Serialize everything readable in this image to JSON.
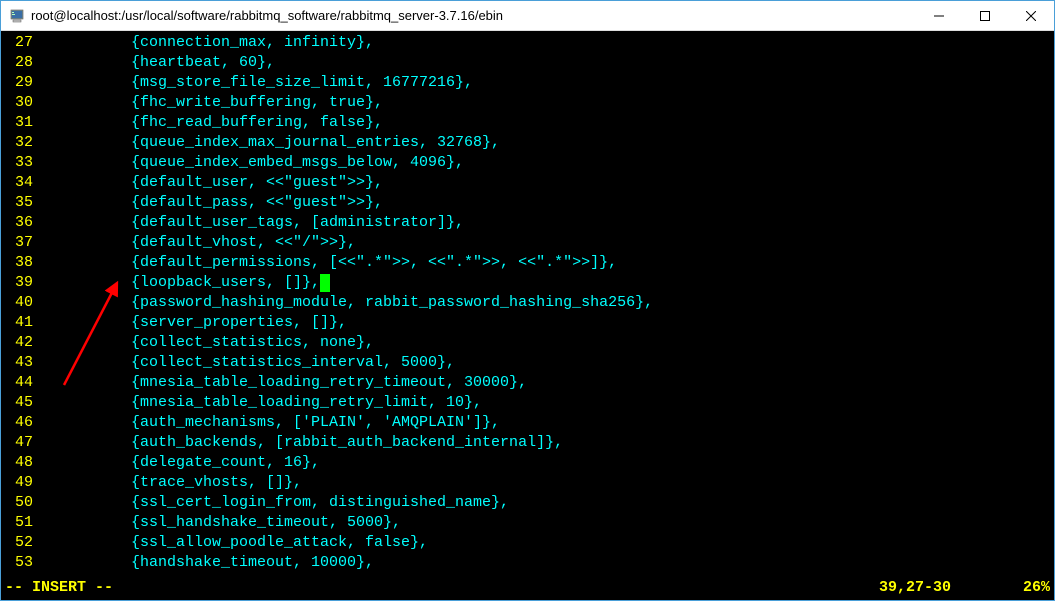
{
  "window": {
    "title": "root@localhost:/usr/local/software/rabbitmq_software/rabbitmq_server-3.7.16/ebin"
  },
  "lines": [
    {
      "n": "27",
      "t": "{connection_max, infinity},"
    },
    {
      "n": "28",
      "t": "{heartbeat, 60},"
    },
    {
      "n": "29",
      "t": "{msg_store_file_size_limit, 16777216},"
    },
    {
      "n": "30",
      "t": "{fhc_write_buffering, true},"
    },
    {
      "n": "31",
      "t": "{fhc_read_buffering, false},"
    },
    {
      "n": "32",
      "t": "{queue_index_max_journal_entries, 32768},"
    },
    {
      "n": "33",
      "t": "{queue_index_embed_msgs_below, 4096},"
    },
    {
      "n": "34",
      "t": "{default_user, <<\"guest\">>},"
    },
    {
      "n": "35",
      "t": "{default_pass, <<\"guest\">>},"
    },
    {
      "n": "36",
      "t": "{default_user_tags, [administrator]},"
    },
    {
      "n": "37",
      "t": "{default_vhost, <<\"/\">>},"
    },
    {
      "n": "38",
      "t": "{default_permissions, [<<\".*\">>, <<\".*\">>, <<\".*\">>]},"
    },
    {
      "n": "39",
      "t": "{loopback_users, []},",
      "cursor": true
    },
    {
      "n": "40",
      "t": "{password_hashing_module, rabbit_password_hashing_sha256},"
    },
    {
      "n": "41",
      "t": "{server_properties, []},"
    },
    {
      "n": "42",
      "t": "{collect_statistics, none},"
    },
    {
      "n": "43",
      "t": "{collect_statistics_interval, 5000},"
    },
    {
      "n": "44",
      "t": "{mnesia_table_loading_retry_timeout, 30000},"
    },
    {
      "n": "45",
      "t": "{mnesia_table_loading_retry_limit, 10},"
    },
    {
      "n": "46",
      "t": "{auth_mechanisms, ['PLAIN', 'AMQPLAIN']},"
    },
    {
      "n": "47",
      "t": "{auth_backends, [rabbit_auth_backend_internal]},"
    },
    {
      "n": "48",
      "t": "{delegate_count, 16},"
    },
    {
      "n": "49",
      "t": "{trace_vhosts, []},"
    },
    {
      "n": "50",
      "t": "{ssl_cert_login_from, distinguished_name},"
    },
    {
      "n": "51",
      "t": "{ssl_handshake_timeout, 5000},"
    },
    {
      "n": "52",
      "t": "{ssl_allow_poodle_attack, false},"
    },
    {
      "n": "53",
      "t": "{handshake_timeout, 10000},"
    }
  ],
  "status": {
    "mode": "-- INSERT --",
    "position": "39,27-30",
    "percent": "26%"
  }
}
